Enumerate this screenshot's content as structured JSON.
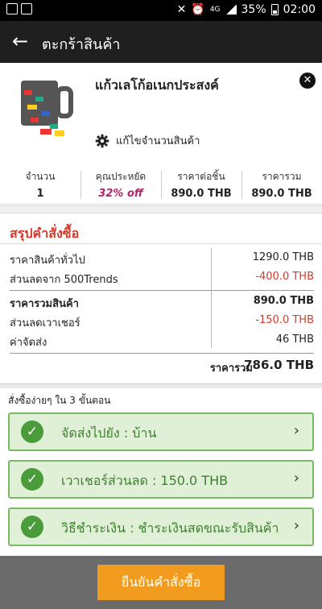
{
  "status_bar": {
    "signal": "4G",
    "battery": "35%",
    "time": "02:00"
  },
  "app_bar": {
    "title": "ตะกร้าสินค้า"
  },
  "product": {
    "name": "แก้วเลโก้อเนกประสงค์",
    "edit_label": "แก้ไขจำนวนสินค้า",
    "stats": [
      {
        "label": "จำนวน",
        "value": "1"
      },
      {
        "label": "คุณประหยัด",
        "value": "32% off"
      },
      {
        "label": "ราคาต่อชิ้น",
        "value": "890.0 THB"
      },
      {
        "label": "ราคารวม",
        "value": "890.0 THB"
      }
    ]
  },
  "summary": {
    "heading": "สรุปคำสั่งซื้อ",
    "rows": [
      {
        "label": "ราคาสินค้าทั่วไป",
        "value": "1290.0 THB"
      },
      {
        "label": "ส่วนลดจาก 500Trends",
        "value": "-400.0 THB"
      },
      {
        "label": "ราคารวมสินค้า",
        "value": "890.0 THB"
      },
      {
        "label": "ส่วนลดเวาเชอร์",
        "value": "-150.0 THB"
      },
      {
        "label": "ค่าจัดส่ง",
        "value": "46 THB"
      }
    ],
    "total_label": "ราคารวม",
    "total_value": "786.0 THB"
  },
  "steps": {
    "title": "สั่งซื้อง่ายๆ ใน 3 ขั้นตอน",
    "items": [
      {
        "label": "จัดส่งไปยัง : บ้าน"
      },
      {
        "label": "เวาเชอร์ส่วนลด : 150.0 THB"
      },
      {
        "label": "วิธีชำระเงิน : ชำระเงินสดขณะรับสินค้า"
      }
    ]
  },
  "confirm_button": "ยืนยันคำสั่งซื้อ",
  "colors": {
    "accent": "#f19c1e",
    "negative": "#d23b2b",
    "success": "#4a9b3a",
    "discount": "#b0246a"
  }
}
